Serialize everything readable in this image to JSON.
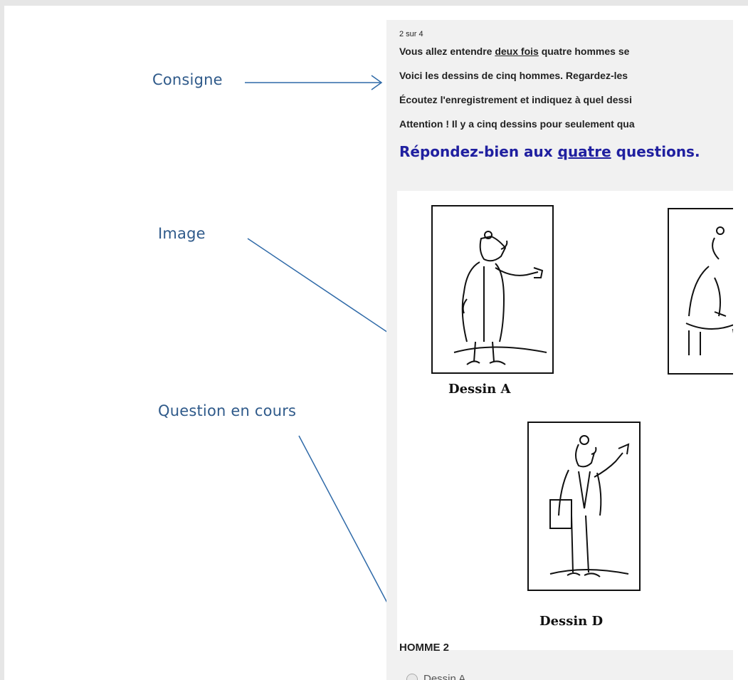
{
  "annotations": {
    "consigne": "Consigne",
    "image": "Image",
    "question": "Question en cours"
  },
  "quiz": {
    "counter": "2  sur 4",
    "instructions": {
      "line1_pre": "Vous allez entendre ",
      "line1_underline": "deux fois",
      "line1_post": " quatre hommes se",
      "line2": "Voici les dessins de cinq hommes. Regardez-les",
      "line3": "Écoutez l'enregistrement et indiquez à quel dessi",
      "line4": "Attention ! Il y a cinq dessins pour seulement qua"
    },
    "prompt": {
      "pre": "Répondez-bien aux ",
      "underline": "quatre",
      "post": " questions."
    },
    "drawings": [
      {
        "caption": "Dessin A"
      },
      {
        "caption": "Dessin D"
      }
    ],
    "question_title": "HOMME 2",
    "options": [
      "Dessin A"
    ]
  },
  "colors": {
    "annotation": "#2f5a8a",
    "prompt": "#2020a0",
    "panel": "#f1f1f1"
  }
}
